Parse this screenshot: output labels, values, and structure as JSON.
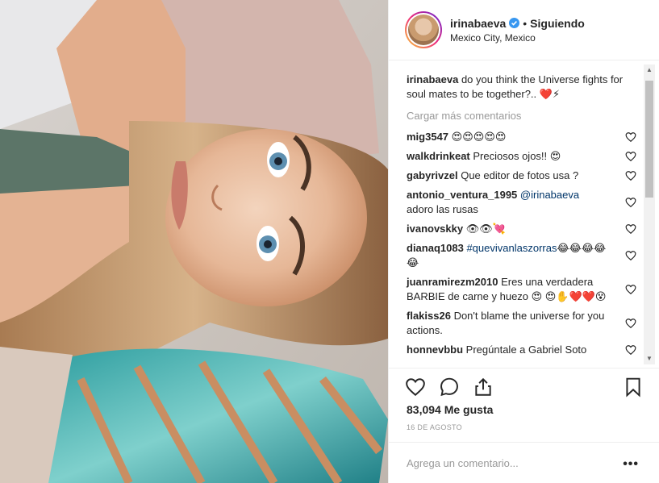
{
  "header": {
    "username": "irinabaeva",
    "separator": "•",
    "follow_status": "Siguiendo",
    "location": "Mexico City, Mexico"
  },
  "caption": {
    "username": "irinabaeva",
    "text": "do you think the Universe fights for soul mates to be together?.. ❤️⚡"
  },
  "load_more_label": "Cargar más comentarios",
  "comments": [
    {
      "user": "mig3547",
      "text": "😍😍😍😍😍"
    },
    {
      "user": "walkdrinkeat",
      "text": "Preciosos ojos!! 😍"
    },
    {
      "user": "gabyrivzel",
      "text": "Que editor de fotos usa ?"
    },
    {
      "user": "antonio_ventura_1995",
      "mention": "@irinabaeva",
      "text": "adoro las rusas"
    },
    {
      "user": "ivanovskky",
      "text": "👁👁💘"
    },
    {
      "user": "dianaq1083",
      "hashtag": "#quevivanlaszorras",
      "text": "😂😂😂😂😂"
    },
    {
      "user": "juanramirezm2010",
      "text": "Eres una verdadera BARBIE de carne y huezo 😍 😍✋❤️❤️😵"
    },
    {
      "user": "flakiss26",
      "text": "Don't blame the universe for you actions."
    },
    {
      "user": "honnevbbu",
      "text": "Pregúntale a Gabriel Soto"
    }
  ],
  "likes_label": "83,094 Me gusta",
  "date_label": "16 DE AGOSTO",
  "add_comment": {
    "placeholder": "Agrega un comentario..."
  },
  "more_label": "•••",
  "icons": {
    "verified": "verified-badge-icon",
    "like": "heart-icon",
    "comment": "comment-bubble-icon",
    "share": "share-icon",
    "save": "bookmark-icon",
    "scroll_up": "scroll-up-arrow",
    "scroll_down": "scroll-down-arrow"
  },
  "scroll_arrows": {
    "up": "▲",
    "down": "▼"
  },
  "colors": {
    "verified": "#3897f0",
    "link": "#003569",
    "muted": "#999999",
    "border": "#efefef"
  }
}
